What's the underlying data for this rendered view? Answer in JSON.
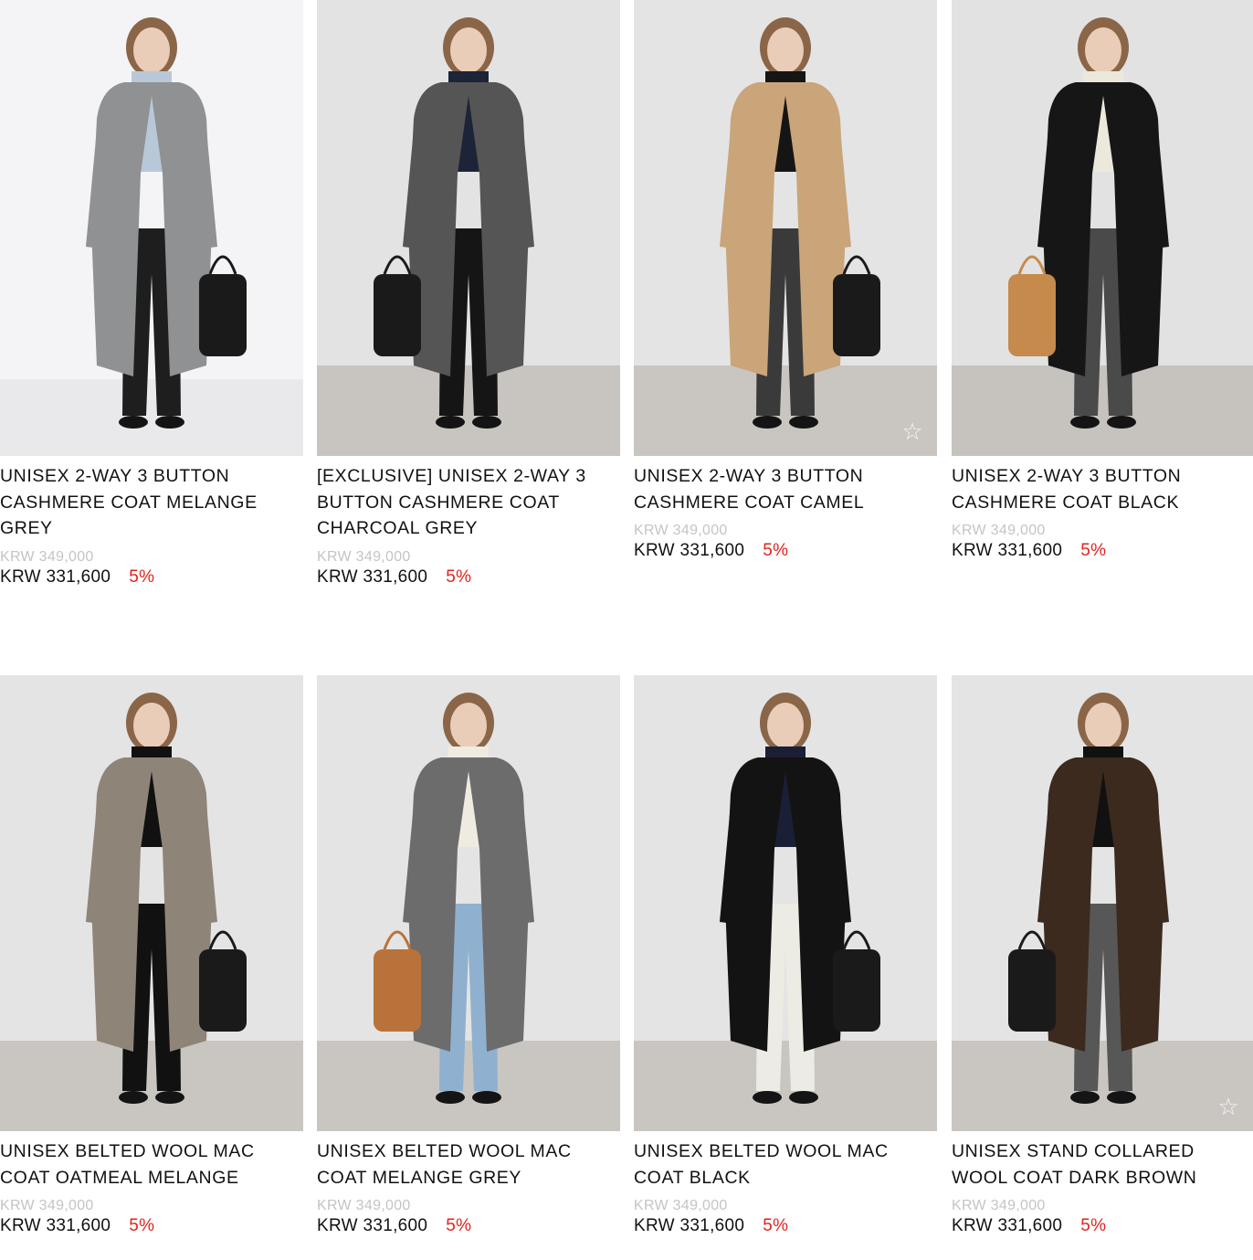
{
  "products": [
    {
      "name": "UNISEX 2-WAY 3 BUTTON CASHMERE COAT MELANGE GREY",
      "original_price": "KRW 349,000",
      "sale_price": "KRW 331,600",
      "discount": "5%",
      "photo": {
        "wall": "#f4f4f6",
        "floor": "#e9e9ec",
        "coat": "#8f9193",
        "accent": "#b9c8d8",
        "pants": "#1e1e1e",
        "bag": "#1a1a1a"
      },
      "wishlist_icon": "star-outline-icon",
      "wishlist_visible": false
    },
    {
      "name": "[EXCLUSIVE] UNISEX 2-WAY 3 BUTTON CASHMERE COAT CHARCOAL GREY",
      "original_price": "KRW 349,000",
      "sale_price": "KRW 331,600",
      "discount": "5%",
      "photo": {
        "wall": "#e3e3e3",
        "floor": "#c8c5c0",
        "coat": "#555555",
        "accent": "#1d2438",
        "pants": "#151515",
        "bag": "#1a1a1a"
      },
      "wishlist_icon": "star-outline-icon",
      "wishlist_visible": false
    },
    {
      "name": "UNISEX 2-WAY 3 BUTTON CASHMERE COAT CAMEL",
      "original_price": "KRW 349,000",
      "sale_price": "KRW 331,600",
      "discount": "5%",
      "photo": {
        "wall": "#e4e4e4",
        "floor": "#c9c6c1",
        "coat": "#caa57a",
        "accent": "#151515",
        "pants": "#3a3a3a",
        "bag": "#1a1a1a"
      },
      "wishlist_icon": "star-outline-icon",
      "wishlist_visible": true
    },
    {
      "name": "UNISEX 2-WAY 3 BUTTON CASHMERE COAT BLACK",
      "original_price": "KRW 349,000",
      "sale_price": "KRW 331,600",
      "discount": "5%",
      "photo": {
        "wall": "#e2e2e2",
        "floor": "#c6c3bf",
        "coat": "#161616",
        "accent": "#ede8dc",
        "pants": "#4a4a4a",
        "bag": "#c68a4c"
      },
      "wishlist_icon": "star-outline-icon",
      "wishlist_visible": false
    },
    {
      "name": "UNISEX BELTED WOOL MAC COAT OATMEAL MELANGE",
      "original_price": "KRW 349,000",
      "sale_price": "KRW 331,600",
      "discount": "5%",
      "photo": {
        "wall": "#e4e4e4",
        "floor": "#c9c6c1",
        "coat": "#8f8478",
        "accent": "#111111",
        "pants": "#111111",
        "bag": "#1a1a1a"
      },
      "wishlist_icon": "star-outline-icon",
      "wishlist_visible": false
    },
    {
      "name": "UNISEX BELTED WOOL MAC COAT MELANGE GREY",
      "original_price": "KRW 349,000",
      "sale_price": "KRW 331,600",
      "discount": "5%",
      "photo": {
        "wall": "#e4e4e4",
        "floor": "#c9c6c1",
        "coat": "#6c6c6c",
        "accent": "#f0ebe0",
        "pants": "#8fb1cf",
        "bag": "#b9723a"
      },
      "wishlist_icon": "star-outline-icon",
      "wishlist_visible": false
    },
    {
      "name": "UNISEX BELTED WOOL MAC COAT BLACK",
      "original_price": "KRW 349,000",
      "sale_price": "KRW 331,600",
      "discount": "5%",
      "photo": {
        "wall": "#e4e4e4",
        "floor": "#c9c6c1",
        "coat": "#131313",
        "accent": "#1b1f35",
        "pants": "#ecebe4",
        "bag": "#1a1a1a"
      },
      "wishlist_icon": "star-outline-icon",
      "wishlist_visible": false
    },
    {
      "name": "UNISEX STAND COLLARED WOOL COAT DARK BROWN",
      "original_price": "KRW 349,000",
      "sale_price": "KRW 331,600",
      "discount": "5%",
      "photo": {
        "wall": "#e4e4e4",
        "floor": "#c9c6c1",
        "coat": "#3b2a1d",
        "accent": "#111111",
        "pants": "#575757",
        "bag": "#1a1a1a"
      },
      "wishlist_icon": "star-outline-icon",
      "wishlist_visible": true
    }
  ]
}
